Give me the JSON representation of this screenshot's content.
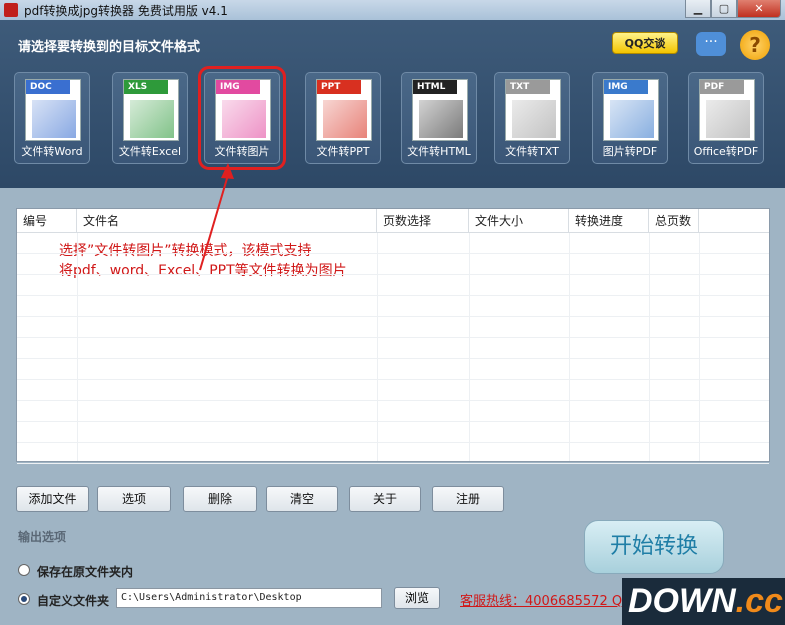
{
  "window": {
    "title": "pdf转换成jpg转换器 免费试用版 v4.1",
    "app_icon": "pdf"
  },
  "header": {
    "title": "请选择要转换到的目标文件格式",
    "qq_label": "QQ交谈"
  },
  "tools": [
    {
      "tag": "DOC",
      "label": "文件转Word",
      "color": "#3a6fd0"
    },
    {
      "tag": "XLS",
      "label": "文件转Excel",
      "color": "#2e9a3a"
    },
    {
      "tag": "IMG",
      "label": "文件转图片",
      "color": "#e24aa0",
      "selected": true
    },
    {
      "tag": "PPT",
      "label": "文件转PPT",
      "color": "#d83020"
    },
    {
      "tag": "HTML",
      "label": "文件转HTML",
      "color": "#222222"
    },
    {
      "tag": "TXT",
      "label": "文件转TXT",
      "color": "#9a9a9a"
    },
    {
      "tag": "IMG",
      "label": "图片转PDF",
      "color": "#3a7acc"
    },
    {
      "tag": "PDF",
      "label": "Office转PDF",
      "color": "#9a9a9a"
    }
  ],
  "table": {
    "columns": [
      "编号",
      "文件名",
      "页数选择",
      "文件大小",
      "转换进度",
      "总页数"
    ]
  },
  "annotation": {
    "line1": "选择”文件转图片”转换模式，该模式支持",
    "line2": "将pdf、word、Excel、PPT等文件转换为图片"
  },
  "buttons": [
    "添加文件",
    "选项",
    "删除",
    "清空",
    "关于",
    "注册"
  ],
  "output": {
    "section_label": "输出选项",
    "option_original": "保存在原文件夹内",
    "option_custom": "自定义文件夹",
    "path": "C:\\Users\\Administrator\\Desktop",
    "browse": "浏览",
    "selected": "custom"
  },
  "hotline": "客服热线：4006685572 QQ",
  "start_button": "开始转换",
  "watermark": {
    "main": "DOWN",
    "suffix": ".cc"
  }
}
